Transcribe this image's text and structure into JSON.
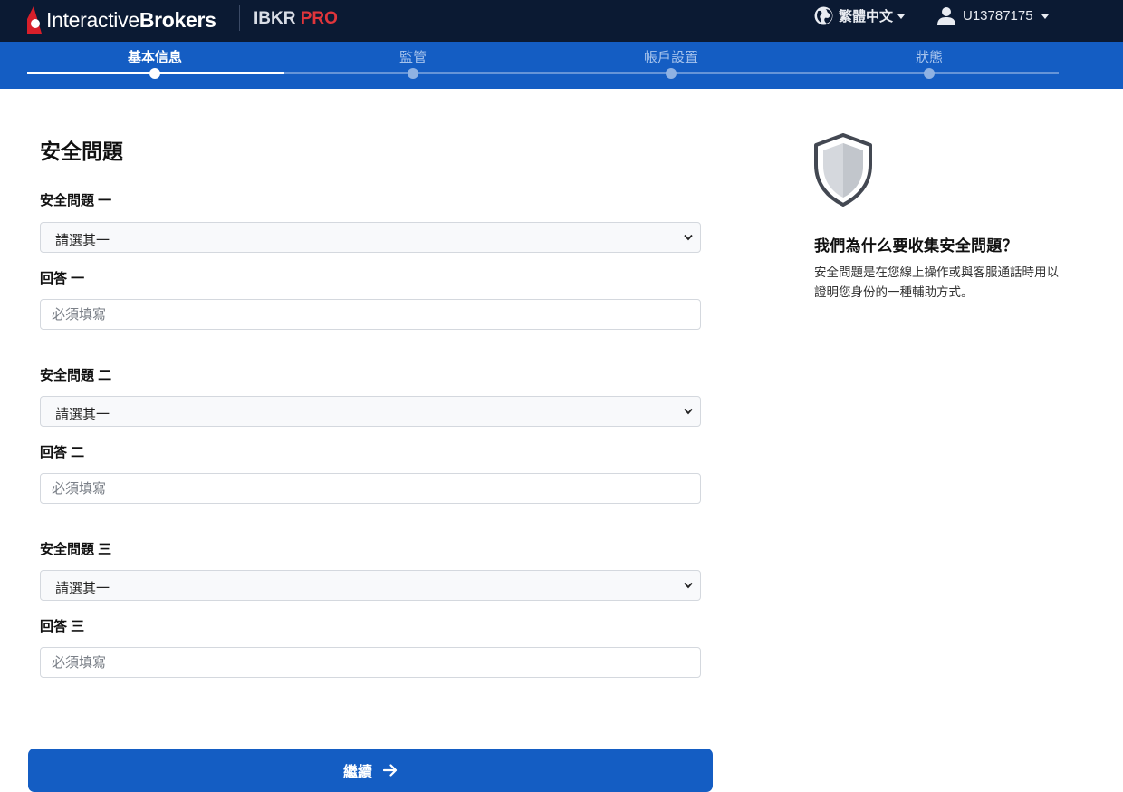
{
  "header": {
    "brand_light": "Interactive",
    "brand_bold": "Brokers",
    "product_name": "IBKR",
    "product_tier": "PRO",
    "language": "繁體中文",
    "user_id": "U13787175"
  },
  "steps": [
    {
      "label": "基本信息",
      "active": true
    },
    {
      "label": "監管",
      "active": false
    },
    {
      "label": "帳戶設置",
      "active": false
    },
    {
      "label": "狀態",
      "active": false
    }
  ],
  "form": {
    "title": "安全問題",
    "questions": [
      {
        "question_label": "安全問題 一",
        "select_value": "請選其一",
        "answer_label": "回答 一",
        "answer_placeholder": "必須填寫"
      },
      {
        "question_label": "安全問題 二",
        "select_value": "請選其一",
        "answer_label": "回答 二",
        "answer_placeholder": "必須填寫"
      },
      {
        "question_label": "安全問題 三",
        "select_value": "請選其一",
        "answer_label": "回答 三",
        "answer_placeholder": "必須填寫"
      }
    ],
    "continue_label": "繼續"
  },
  "info": {
    "title": "我們為什么要收集安全問題？",
    "text": "安全問題是在您線上操作或與客服通話時用以證明您身份的一種輔助方式。"
  },
  "colors": {
    "topbar": "#0b1a33",
    "accent_blue": "#145dc3",
    "brand_red": "#e0353b"
  }
}
